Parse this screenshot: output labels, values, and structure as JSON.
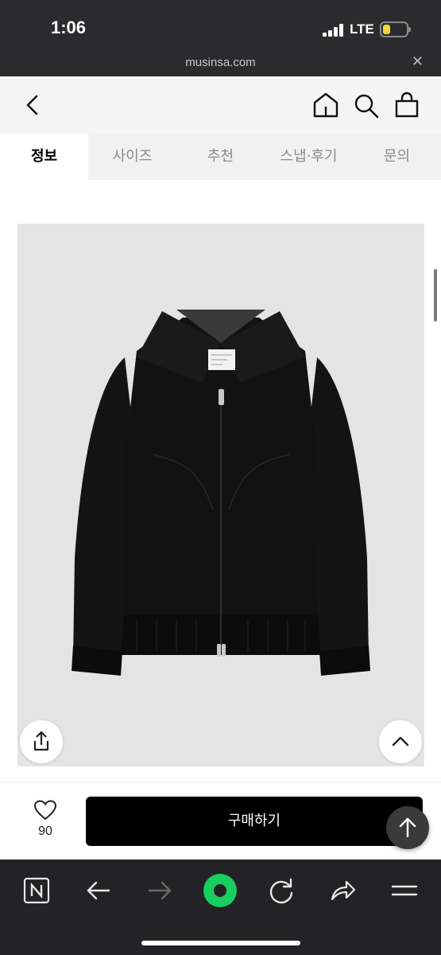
{
  "status_bar": {
    "time": "1:06",
    "network": "LTE",
    "battery_level": 0.3,
    "battery_color": "#f6d53c"
  },
  "browser": {
    "domain": "musinsa.com",
    "close_icon": "close-icon"
  },
  "header": {
    "back_icon": "chevron-left-icon",
    "home_icon": "home-icon",
    "search_icon": "search-icon",
    "cart_icon": "shopping-bag-icon"
  },
  "tabs": [
    {
      "label": "정보",
      "active": true
    },
    {
      "label": "사이즈",
      "active": false
    },
    {
      "label": "추천",
      "active": false
    },
    {
      "label": "스냅·후기",
      "active": false
    },
    {
      "label": "문의",
      "active": false
    }
  ],
  "product": {
    "image_icon": "black-suede-jacket-image",
    "background_color": "#e4e4e4"
  },
  "purchase": {
    "like_count": "90",
    "buy_label": "구매하기",
    "buy_color": "#000000"
  },
  "browser_nav": {
    "items": [
      "naver-icon",
      "back-arrow-icon",
      "forward-arrow-icon",
      "green-home-icon",
      "reload-icon",
      "share-icon",
      "menu-icon"
    ],
    "accent_color": "#19ce60"
  }
}
